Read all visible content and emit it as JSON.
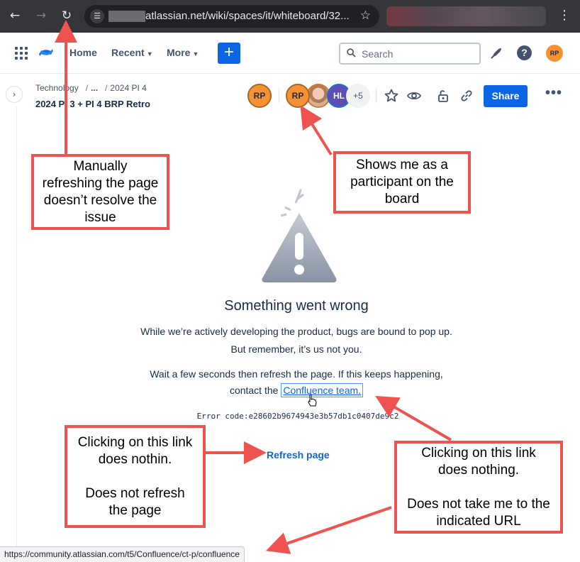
{
  "browser": {
    "url_text": "atlassian.net/wiki/spaces/it/whiteboard/32...",
    "back_icon": "back-arrow-icon",
    "forward_icon": "forward-arrow-icon",
    "reload_icon": "reload-icon",
    "star_icon": "bookmark-star-icon",
    "menu_icon": "kebab-menu-icon",
    "status_url": "https://community.atlassian.com/t5/Confluence/ct-p/confluence"
  },
  "topnav": {
    "home": "Home",
    "recent": "Recent",
    "more": "More",
    "create": "+",
    "search_placeholder": "Search",
    "help": "?",
    "user_initials": "RP"
  },
  "page": {
    "breadcrumb": [
      "Technology",
      "...",
      "2024 PI 4"
    ],
    "title": "2024 PI 3 + PI 4 BRP Retro",
    "owner_initials": "RP",
    "participants": [
      {
        "initials": "RP",
        "color": "#f79232"
      },
      {
        "initials": "",
        "color": "#f3cbb2"
      },
      {
        "initials": "HL",
        "color": "#5e4db2"
      }
    ],
    "more_participants": "+5",
    "share": "Share",
    "more_actions": "•••"
  },
  "error": {
    "title": "Something went wrong",
    "line1": "While we’re actively developing the product, bugs are bound to pop up.",
    "line2": "But remember, it’s us not you.",
    "line3": "Wait a few seconds then refresh the page. If this keeps happening,",
    "line4_prefix": "contact the",
    "link": "Confluence team.",
    "code": "Error code:e28602b9674943e3b57db1c0407de9c2",
    "refresh": "Refresh page"
  },
  "annotations": {
    "refresh_note": [
      "Manually",
      "refreshing the page",
      "doesn’t resolve the",
      "issue"
    ],
    "participant_note": [
      "Shows me as a",
      "participant on the",
      "board"
    ],
    "refresh_link_note": [
      "Clicking on this link",
      "does nothin.",
      "",
      "Does not refresh",
      "the page"
    ],
    "team_link_note": [
      "Clicking on this link",
      "does nothing.",
      "",
      "Does not take me to the",
      "indicated URL"
    ],
    "accent_color": "#ef5350"
  },
  "colors": {
    "brand_blue": "#0c66e4",
    "text_dark": "#172b4d",
    "avatar_orange": "#f79232"
  }
}
